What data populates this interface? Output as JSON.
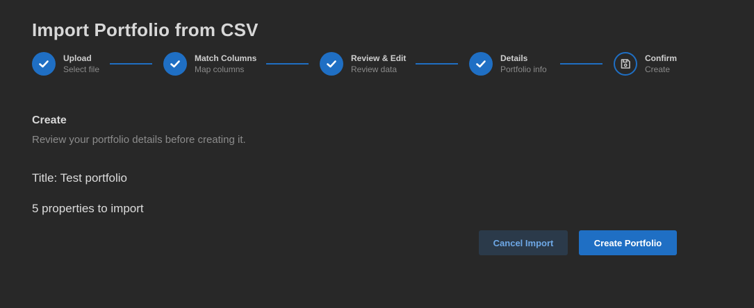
{
  "header": {
    "title": "Import Portfolio from CSV"
  },
  "stepper": {
    "steps": [
      {
        "label": "Upload",
        "sub": "Select file",
        "state": "complete",
        "icon": "check-icon"
      },
      {
        "label": "Match Columns",
        "sub": "Map columns",
        "state": "complete",
        "icon": "check-icon"
      },
      {
        "label": "Review & Edit",
        "sub": "Review data",
        "state": "complete",
        "icon": "check-icon"
      },
      {
        "label": "Details",
        "sub": "Portfolio info",
        "state": "complete",
        "icon": "check-icon"
      },
      {
        "label": "Confirm",
        "sub": "Create",
        "state": "active",
        "icon": "save-icon"
      }
    ]
  },
  "section": {
    "title": "Create",
    "description": "Review your portfolio details before creating it."
  },
  "summary": {
    "title_line": "Title: Test portfolio",
    "count_line": "5 properties to import"
  },
  "actions": {
    "cancel_label": "Cancel Import",
    "create_label": "Create Portfolio"
  },
  "colors": {
    "background": "#282828",
    "accent": "#1f6fc4",
    "cancel_bg": "#2b3a4a",
    "cancel_text": "#6ea8e6"
  }
}
